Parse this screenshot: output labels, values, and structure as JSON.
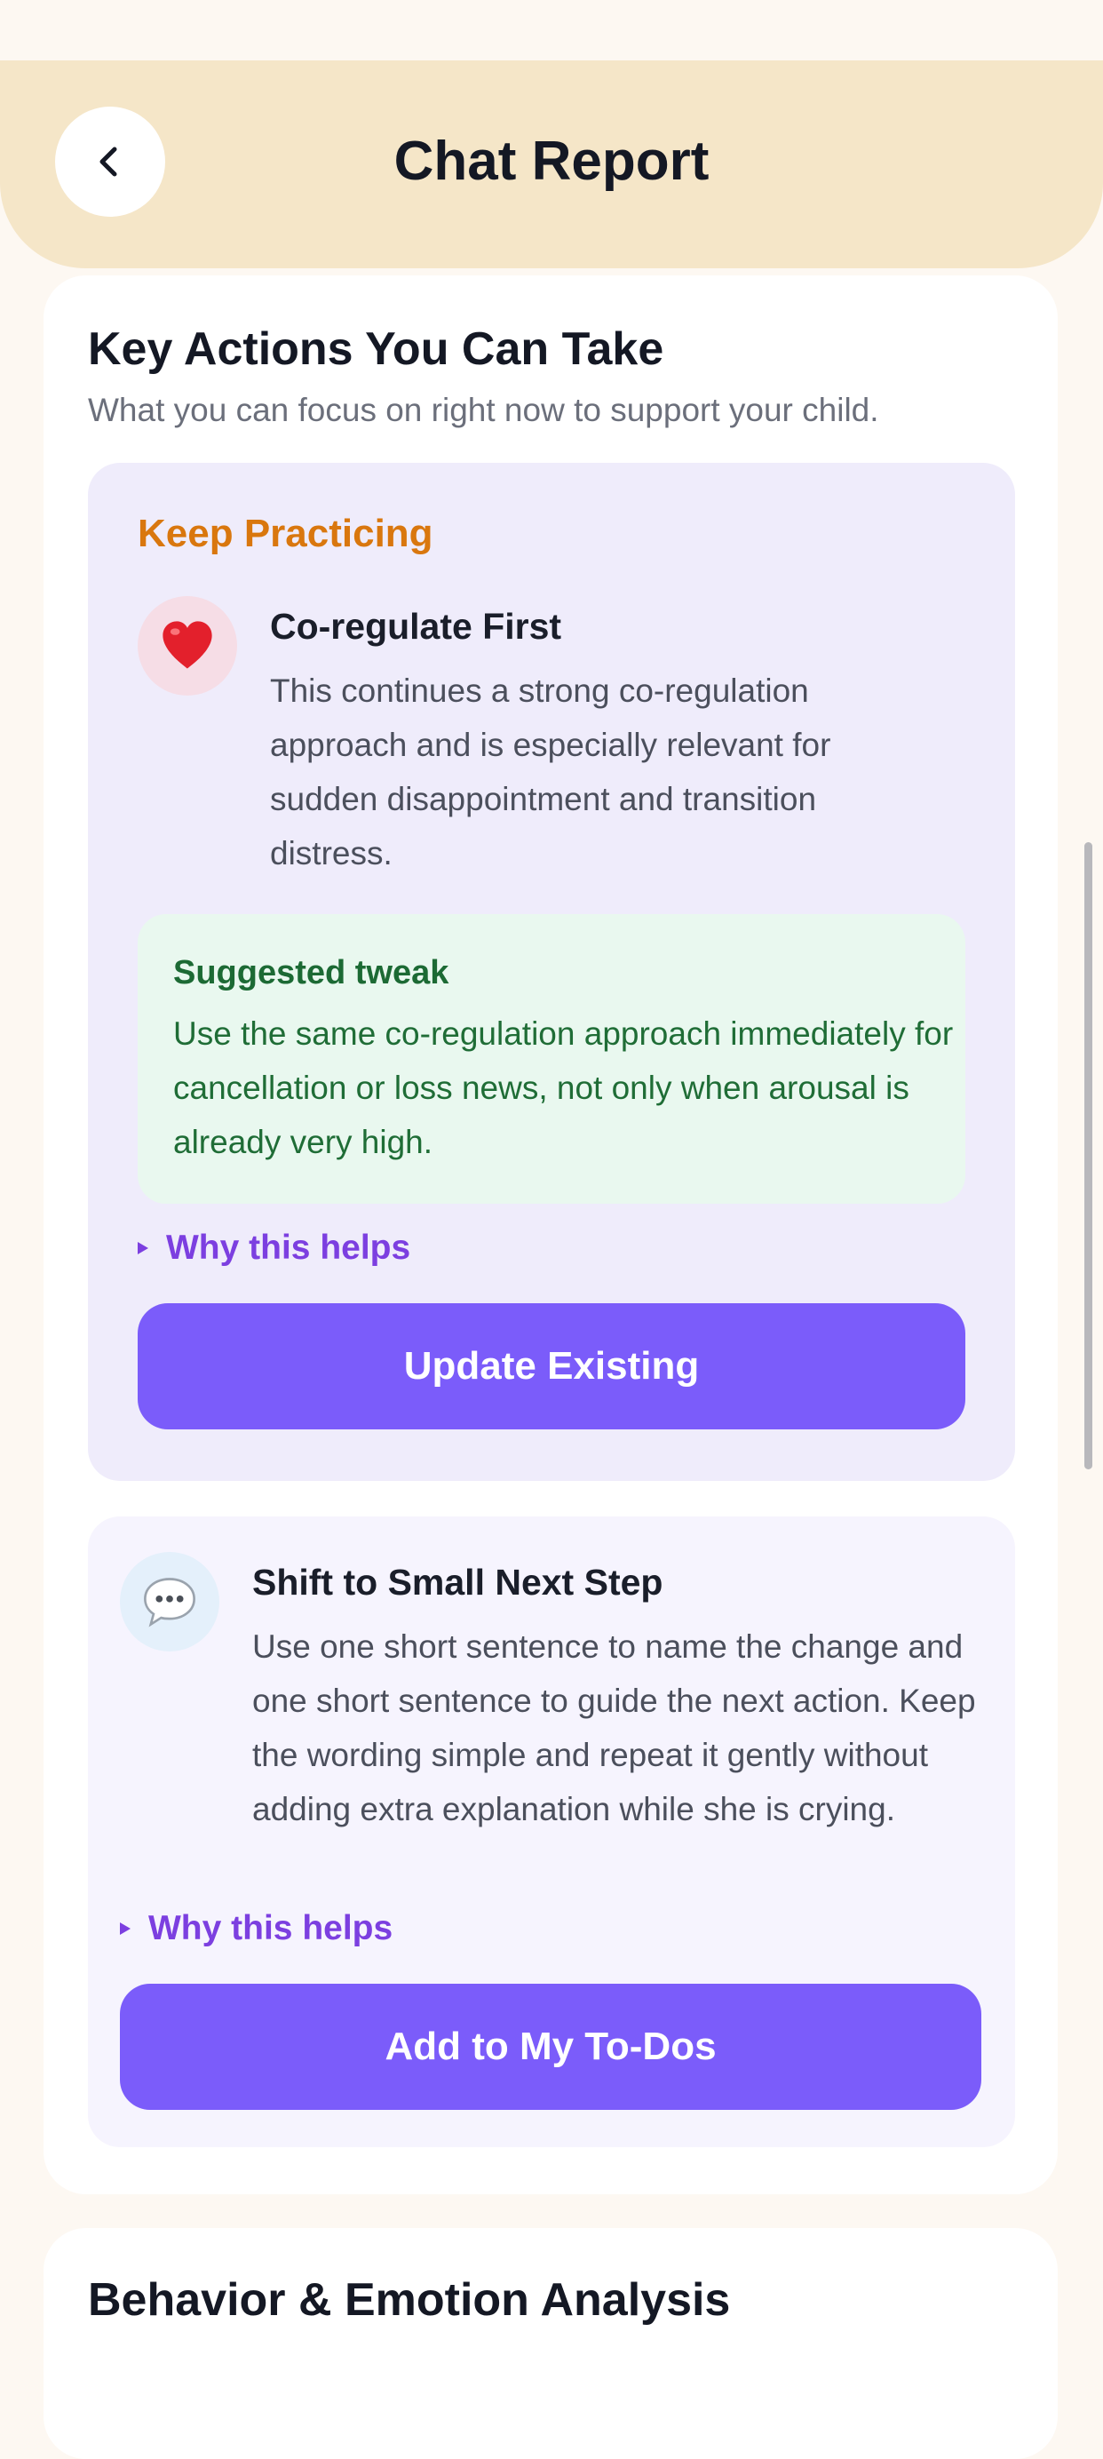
{
  "header": {
    "title": "Chat Report",
    "back_icon": "chevron-left-icon"
  },
  "key_actions": {
    "title": "Key Actions You Can Take",
    "subtitle": "What you can focus on right now to support your child.",
    "items": [
      {
        "tag": "Keep Practicing",
        "icon": "heart-icon",
        "title": "Co-regulate First",
        "body": "This continues a strong co-regulation approach and is especially relevant for sudden disappointment and transition distress.",
        "tweak_title": "Suggested tweak",
        "tweak_body": "Use the same co-regulation approach immediately for cancellation or loss news, not only when arousal is already very high.",
        "why_label": "Why this helps",
        "button_label": "Update Existing"
      },
      {
        "icon": "speech-bubble-icon",
        "title": "Shift to Small Next Step",
        "body": "Use one short sentence to name the change and one short sentence to guide the next action. Keep the wording simple and repeat it gently without adding extra explanation while she is crying.",
        "why_label": "Why this helps",
        "button_label": "Add to My To-Dos"
      }
    ]
  },
  "behavior_section": {
    "title": "Behavior & Emotion Analysis"
  },
  "colors": {
    "header_bg": "#f5e6c8",
    "accent_purple": "#7b5cfa",
    "tag_orange": "#d9770e",
    "tweak_green": "#1c6a34"
  }
}
